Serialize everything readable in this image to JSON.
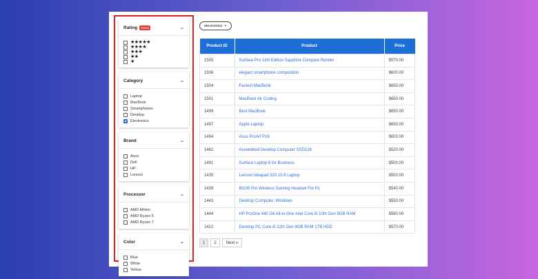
{
  "filters": [
    {
      "title": "Rating",
      "badge": "Reset",
      "options": [
        {
          "label": "★★★★★",
          "checked": false
        },
        {
          "label": "★★★★",
          "checked": false
        },
        {
          "label": "★★★",
          "checked": false
        },
        {
          "label": "★★",
          "checked": false
        },
        {
          "label": "★",
          "checked": false
        }
      ]
    },
    {
      "title": "Category",
      "options": [
        {
          "label": "Laptop",
          "checked": false
        },
        {
          "label": "MacBook",
          "checked": false
        },
        {
          "label": "Smartphones",
          "checked": false
        },
        {
          "label": "Desktop",
          "checked": false
        },
        {
          "label": "Electronics",
          "checked": true
        }
      ]
    },
    {
      "title": "Brand",
      "options": [
        {
          "label": "Asus",
          "checked": false
        },
        {
          "label": "Dell",
          "checked": false
        },
        {
          "label": "HP",
          "checked": false
        },
        {
          "label": "Lenovo",
          "checked": false
        }
      ]
    },
    {
      "title": "Processor",
      "options": [
        {
          "label": "AMD Athlon",
          "checked": false
        },
        {
          "label": "AMD Ryzen 5",
          "checked": false
        },
        {
          "label": "AMD Ryzen 7",
          "checked": false
        }
      ]
    },
    {
      "title": "Color",
      "options": [
        {
          "label": "Blue",
          "checked": false
        },
        {
          "label": "White",
          "checked": false
        },
        {
          "label": "Yellow",
          "checked": false
        }
      ]
    }
  ],
  "chip": {
    "label": "electronics",
    "close": "×"
  },
  "table": {
    "headers": [
      "Product ID",
      "Product",
      "Price"
    ],
    "rows": [
      [
        "1505",
        "Surface Pro 11th Edition Sapphire Compare Render",
        "$570.00"
      ],
      [
        "1506",
        "elegant smartphone composition",
        "$600.00"
      ],
      [
        "1504",
        "Fastest MacBook",
        "$650.00"
      ],
      [
        "1501",
        "MacBook Air Coding",
        "$650.00"
      ],
      [
        "1499",
        "Best MacBook",
        "$650.00"
      ],
      [
        "1497",
        "Apple Laptop",
        "$650.00"
      ],
      [
        "1494",
        "Asus ProArt P16",
        "$600.00"
      ],
      [
        "1482",
        "Assembled Desktop Computer SSD128",
        "$520.00"
      ],
      [
        "1491",
        "Surface Laptop 6 for Business",
        "$500.00"
      ],
      [
        "1435",
        "Lenovo Ideapad 320 15.6 Laptop",
        "$500.00"
      ],
      [
        "1439",
        "Bt100 Pro Wireless Gaming Headset For Pc",
        "$540.00"
      ],
      [
        "1443",
        "Desktop Computer, Windows",
        "$550.00"
      ],
      [
        "1444",
        "HP ProOne 440 G6 All-in-One Intel Core i5 10th Gen 8GB RAM",
        "$560.00"
      ],
      [
        "1422",
        "Desktop PC Core i5 12th Gen 8GB RAM 1TB HDD",
        "$570.00"
      ]
    ]
  },
  "pagination": {
    "pages": [
      "1",
      "2"
    ],
    "next": "Next »",
    "active": "1"
  },
  "colors": {
    "accent": "#1d6fd6",
    "highlight_border": "#e02020",
    "badge": "#e03b3b"
  }
}
